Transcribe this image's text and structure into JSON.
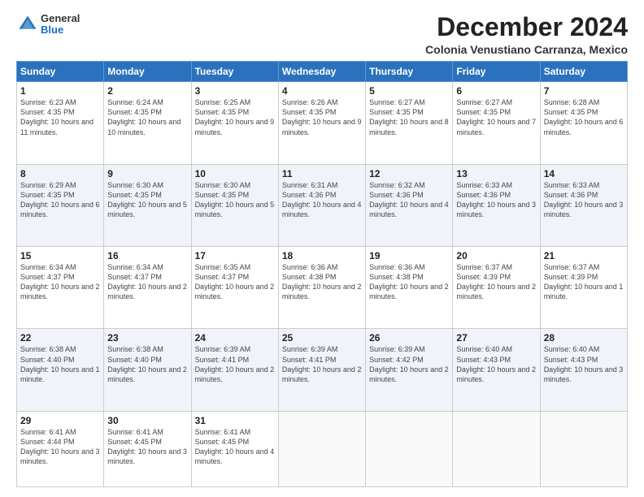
{
  "header": {
    "logo_general": "General",
    "logo_blue": "Blue",
    "title": "December 2024",
    "subtitle": "Colonia Venustiano Carranza, Mexico"
  },
  "days_of_week": [
    "Sunday",
    "Monday",
    "Tuesday",
    "Wednesday",
    "Thursday",
    "Friday",
    "Saturday"
  ],
  "weeks": [
    [
      {
        "day": "1",
        "sunrise": "6:23 AM",
        "sunset": "4:35 PM",
        "daylight": "10 hours and 11 minutes."
      },
      {
        "day": "2",
        "sunrise": "6:24 AM",
        "sunset": "4:35 PM",
        "daylight": "10 hours and 10 minutes."
      },
      {
        "day": "3",
        "sunrise": "6:25 AM",
        "sunset": "4:35 PM",
        "daylight": "10 hours and 9 minutes."
      },
      {
        "day": "4",
        "sunrise": "6:26 AM",
        "sunset": "4:35 PM",
        "daylight": "10 hours and 9 minutes."
      },
      {
        "day": "5",
        "sunrise": "6:27 AM",
        "sunset": "4:35 PM",
        "daylight": "10 hours and 8 minutes."
      },
      {
        "day": "6",
        "sunrise": "6:27 AM",
        "sunset": "4:35 PM",
        "daylight": "10 hours and 7 minutes."
      },
      {
        "day": "7",
        "sunrise": "6:28 AM",
        "sunset": "4:35 PM",
        "daylight": "10 hours and 6 minutes."
      }
    ],
    [
      {
        "day": "8",
        "sunrise": "6:29 AM",
        "sunset": "4:35 PM",
        "daylight": "10 hours and 6 minutes."
      },
      {
        "day": "9",
        "sunrise": "6:30 AM",
        "sunset": "4:35 PM",
        "daylight": "10 hours and 5 minutes."
      },
      {
        "day": "10",
        "sunrise": "6:30 AM",
        "sunset": "4:35 PM",
        "daylight": "10 hours and 5 minutes."
      },
      {
        "day": "11",
        "sunrise": "6:31 AM",
        "sunset": "4:36 PM",
        "daylight": "10 hours and 4 minutes."
      },
      {
        "day": "12",
        "sunrise": "6:32 AM",
        "sunset": "4:36 PM",
        "daylight": "10 hours and 4 minutes."
      },
      {
        "day": "13",
        "sunrise": "6:33 AM",
        "sunset": "4:36 PM",
        "daylight": "10 hours and 3 minutes."
      },
      {
        "day": "14",
        "sunrise": "6:33 AM",
        "sunset": "4:36 PM",
        "daylight": "10 hours and 3 minutes."
      }
    ],
    [
      {
        "day": "15",
        "sunrise": "6:34 AM",
        "sunset": "4:37 PM",
        "daylight": "10 hours and 2 minutes."
      },
      {
        "day": "16",
        "sunrise": "6:34 AM",
        "sunset": "4:37 PM",
        "daylight": "10 hours and 2 minutes."
      },
      {
        "day": "17",
        "sunrise": "6:35 AM",
        "sunset": "4:37 PM",
        "daylight": "10 hours and 2 minutes."
      },
      {
        "day": "18",
        "sunrise": "6:36 AM",
        "sunset": "4:38 PM",
        "daylight": "10 hours and 2 minutes."
      },
      {
        "day": "19",
        "sunrise": "6:36 AM",
        "sunset": "4:38 PM",
        "daylight": "10 hours and 2 minutes."
      },
      {
        "day": "20",
        "sunrise": "6:37 AM",
        "sunset": "4:39 PM",
        "daylight": "10 hours and 2 minutes."
      },
      {
        "day": "21",
        "sunrise": "6:37 AM",
        "sunset": "4:39 PM",
        "daylight": "10 hours and 1 minute."
      }
    ],
    [
      {
        "day": "22",
        "sunrise": "6:38 AM",
        "sunset": "4:40 PM",
        "daylight": "10 hours and 1 minute."
      },
      {
        "day": "23",
        "sunrise": "6:38 AM",
        "sunset": "4:40 PM",
        "daylight": "10 hours and 2 minutes."
      },
      {
        "day": "24",
        "sunrise": "6:39 AM",
        "sunset": "4:41 PM",
        "daylight": "10 hours and 2 minutes."
      },
      {
        "day": "25",
        "sunrise": "6:39 AM",
        "sunset": "4:41 PM",
        "daylight": "10 hours and 2 minutes."
      },
      {
        "day": "26",
        "sunrise": "6:39 AM",
        "sunset": "4:42 PM",
        "daylight": "10 hours and 2 minutes."
      },
      {
        "day": "27",
        "sunrise": "6:40 AM",
        "sunset": "4:43 PM",
        "daylight": "10 hours and 2 minutes."
      },
      {
        "day": "28",
        "sunrise": "6:40 AM",
        "sunset": "4:43 PM",
        "daylight": "10 hours and 3 minutes."
      }
    ],
    [
      {
        "day": "29",
        "sunrise": "6:41 AM",
        "sunset": "4:44 PM",
        "daylight": "10 hours and 3 minutes."
      },
      {
        "day": "30",
        "sunrise": "6:41 AM",
        "sunset": "4:45 PM",
        "daylight": "10 hours and 3 minutes."
      },
      {
        "day": "31",
        "sunrise": "6:41 AM",
        "sunset": "4:45 PM",
        "daylight": "10 hours and 4 minutes."
      },
      null,
      null,
      null,
      null
    ]
  ]
}
